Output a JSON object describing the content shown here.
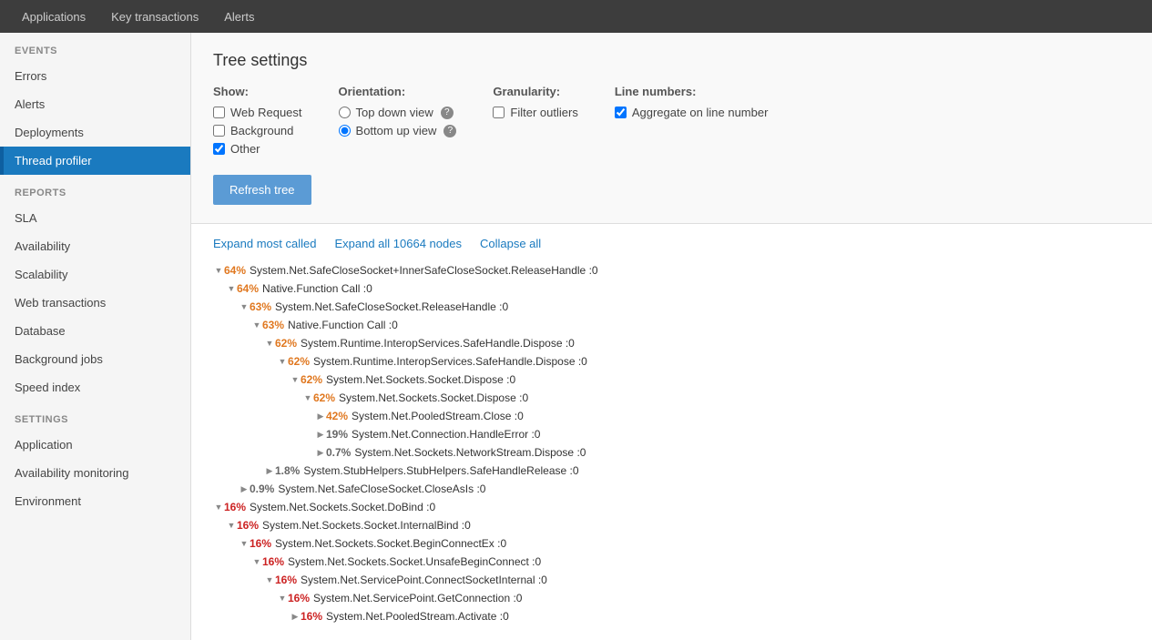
{
  "topnav": {
    "items": [
      {
        "label": "Applications",
        "active": false
      },
      {
        "label": "Key transactions",
        "active": false
      },
      {
        "label": "Alerts",
        "active": false
      }
    ]
  },
  "sidebar": {
    "events_label": "EVENTS",
    "events_items": [
      {
        "label": "Errors",
        "active": false
      },
      {
        "label": "Alerts",
        "active": false
      },
      {
        "label": "Deployments",
        "active": false
      },
      {
        "label": "Thread profiler",
        "active": true
      }
    ],
    "reports_label": "REPORTS",
    "reports_items": [
      {
        "label": "SLA",
        "active": false
      },
      {
        "label": "Availability",
        "active": false
      },
      {
        "label": "Scalability",
        "active": false
      },
      {
        "label": "Web transactions",
        "active": false
      },
      {
        "label": "Database",
        "active": false
      },
      {
        "label": "Background jobs",
        "active": false
      },
      {
        "label": "Speed index",
        "active": false
      }
    ],
    "settings_label": "SETTINGS",
    "settings_items": [
      {
        "label": "Application",
        "active": false
      },
      {
        "label": "Availability monitoring",
        "active": false
      },
      {
        "label": "Environment",
        "active": false
      }
    ]
  },
  "tree_settings": {
    "title": "Tree settings",
    "show_label": "Show:",
    "checkboxes": [
      {
        "label": "Web Request",
        "checked": false
      },
      {
        "label": "Background",
        "checked": false
      },
      {
        "label": "Other",
        "checked": true
      }
    ],
    "orientation_label": "Orientation:",
    "orientation_options": [
      {
        "label": "Top down view",
        "checked": false,
        "has_info": true
      },
      {
        "label": "Bottom up view",
        "checked": true,
        "has_info": true
      }
    ],
    "granularity_label": "Granularity:",
    "granularity_checkboxes": [
      {
        "label": "Filter outliers",
        "checked": false
      }
    ],
    "line_numbers_label": "Line numbers:",
    "line_numbers_checkboxes": [
      {
        "label": "Aggregate on line number",
        "checked": true
      }
    ],
    "refresh_btn": "Refresh tree"
  },
  "tree_controls": {
    "expand_most": "Expand most called",
    "expand_all": "Expand all 10664 nodes",
    "collapse_all": "Collapse all"
  },
  "tree_rows": [
    {
      "indent": 0,
      "expand": "▼",
      "pct": "64%",
      "pct_class": "orange",
      "text": "System.Net.SafeCloseSocket+InnerSafeCloseSocket.ReleaseHandle :0"
    },
    {
      "indent": 1,
      "expand": "▼",
      "pct": "64%",
      "pct_class": "orange",
      "text": "Native.Function Call :0"
    },
    {
      "indent": 2,
      "expand": "▼",
      "pct": "63%",
      "pct_class": "orange",
      "text": "System.Net.SafeCloseSocket.ReleaseHandle :0"
    },
    {
      "indent": 3,
      "expand": "▼",
      "pct": "63%",
      "pct_class": "orange",
      "text": "Native.Function Call :0"
    },
    {
      "indent": 4,
      "expand": "▼",
      "pct": "62%",
      "pct_class": "orange",
      "text": "System.Runtime.InteropServices.SafeHandle.Dispose :0"
    },
    {
      "indent": 5,
      "expand": "▼",
      "pct": "62%",
      "pct_class": "orange",
      "text": "System.Runtime.InteropServices.SafeHandle.Dispose :0"
    },
    {
      "indent": 6,
      "expand": "▼",
      "pct": "62%",
      "pct_class": "orange",
      "text": "System.Net.Sockets.Socket.Dispose :0"
    },
    {
      "indent": 7,
      "expand": "▼",
      "pct": "62%",
      "pct_class": "orange",
      "text": "System.Net.Sockets.Socket.Dispose :0"
    },
    {
      "indent": 8,
      "expand": "▶",
      "pct": "42%",
      "pct_class": "orange",
      "text": "System.Net.PooledStream.Close :0"
    },
    {
      "indent": 8,
      "expand": "▶",
      "pct": "19%",
      "pct_class": "dark",
      "text": "System.Net.Connection.HandleError :0"
    },
    {
      "indent": 8,
      "expand": "▶",
      "pct": "0.7%",
      "pct_class": "dark",
      "text": "System.Net.Sockets.NetworkStream.Dispose :0"
    },
    {
      "indent": 4,
      "expand": "▶",
      "pct": "1.8%",
      "pct_class": "dark",
      "text": "System.StubHelpers.StubHelpers.SafeHandleRelease :0"
    },
    {
      "indent": 2,
      "expand": "▶",
      "pct": "0.9%",
      "pct_class": "dark",
      "text": "System.Net.SafeCloseSocket.CloseAsIs :0"
    },
    {
      "indent": 0,
      "expand": "▼",
      "pct": "16%",
      "pct_class": "red",
      "text": "System.Net.Sockets.Socket.DoBind :0"
    },
    {
      "indent": 1,
      "expand": "▼",
      "pct": "16%",
      "pct_class": "red",
      "text": "System.Net.Sockets.Socket.InternalBind :0"
    },
    {
      "indent": 2,
      "expand": "▼",
      "pct": "16%",
      "pct_class": "red",
      "text": "System.Net.Sockets.Socket.BeginConnectEx :0"
    },
    {
      "indent": 3,
      "expand": "▼",
      "pct": "16%",
      "pct_class": "red",
      "text": "System.Net.Sockets.Socket.UnsafeBeginConnect :0"
    },
    {
      "indent": 4,
      "expand": "▼",
      "pct": "16%",
      "pct_class": "red",
      "text": "System.Net.ServicePoint.ConnectSocketInternal :0"
    },
    {
      "indent": 5,
      "expand": "▼",
      "pct": "16%",
      "pct_class": "red",
      "text": "System.Net.ServicePoint.GetConnection :0"
    },
    {
      "indent": 6,
      "expand": "▶",
      "pct": "16%",
      "pct_class": "red",
      "text": "System.Net.PooledStream.Activate :0"
    }
  ]
}
